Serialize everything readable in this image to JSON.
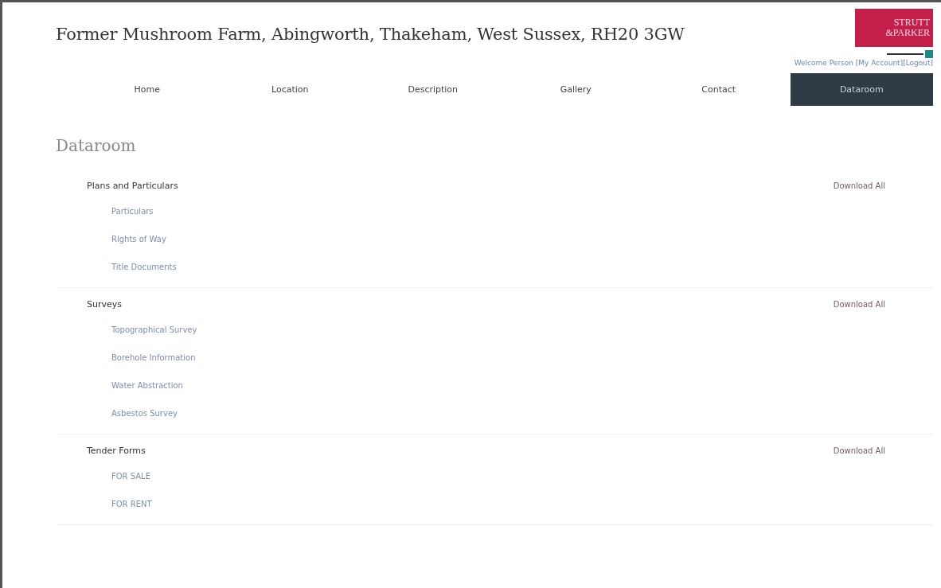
{
  "page": {
    "title": "Former Mushroom Farm, Abingworth, Thakeham, West Sussex, RH20 3GW"
  },
  "logo": {
    "lines": [
      "STRUTT",
      "&PARKER"
    ]
  },
  "account": {
    "text": "Welcome Person [My Account][Logout]"
  },
  "nav": [
    {
      "label": "Home",
      "selected": false
    },
    {
      "label": "Location",
      "selected": false
    },
    {
      "label": "Description",
      "selected": false
    },
    {
      "label": "Gallery",
      "selected": false
    },
    {
      "label": "Contact",
      "selected": false
    },
    {
      "label": "Dataroom",
      "selected": true
    }
  ],
  "heading": "Dataroom",
  "sections": [
    {
      "title": "Plans and Particulars",
      "action": "Download All",
      "items": [
        "Particulars",
        "Rights of Way",
        "Title Documents"
      ]
    },
    {
      "title": "Surveys",
      "action": "Download All",
      "items": [
        "Topographical Survey",
        "Borehole Information",
        "Water Abstraction",
        "Asbestos Survey"
      ]
    },
    {
      "title": "Tender Forms",
      "action": "Download All",
      "items": [
        "FOR SALE",
        "FOR RENT"
      ]
    }
  ]
}
